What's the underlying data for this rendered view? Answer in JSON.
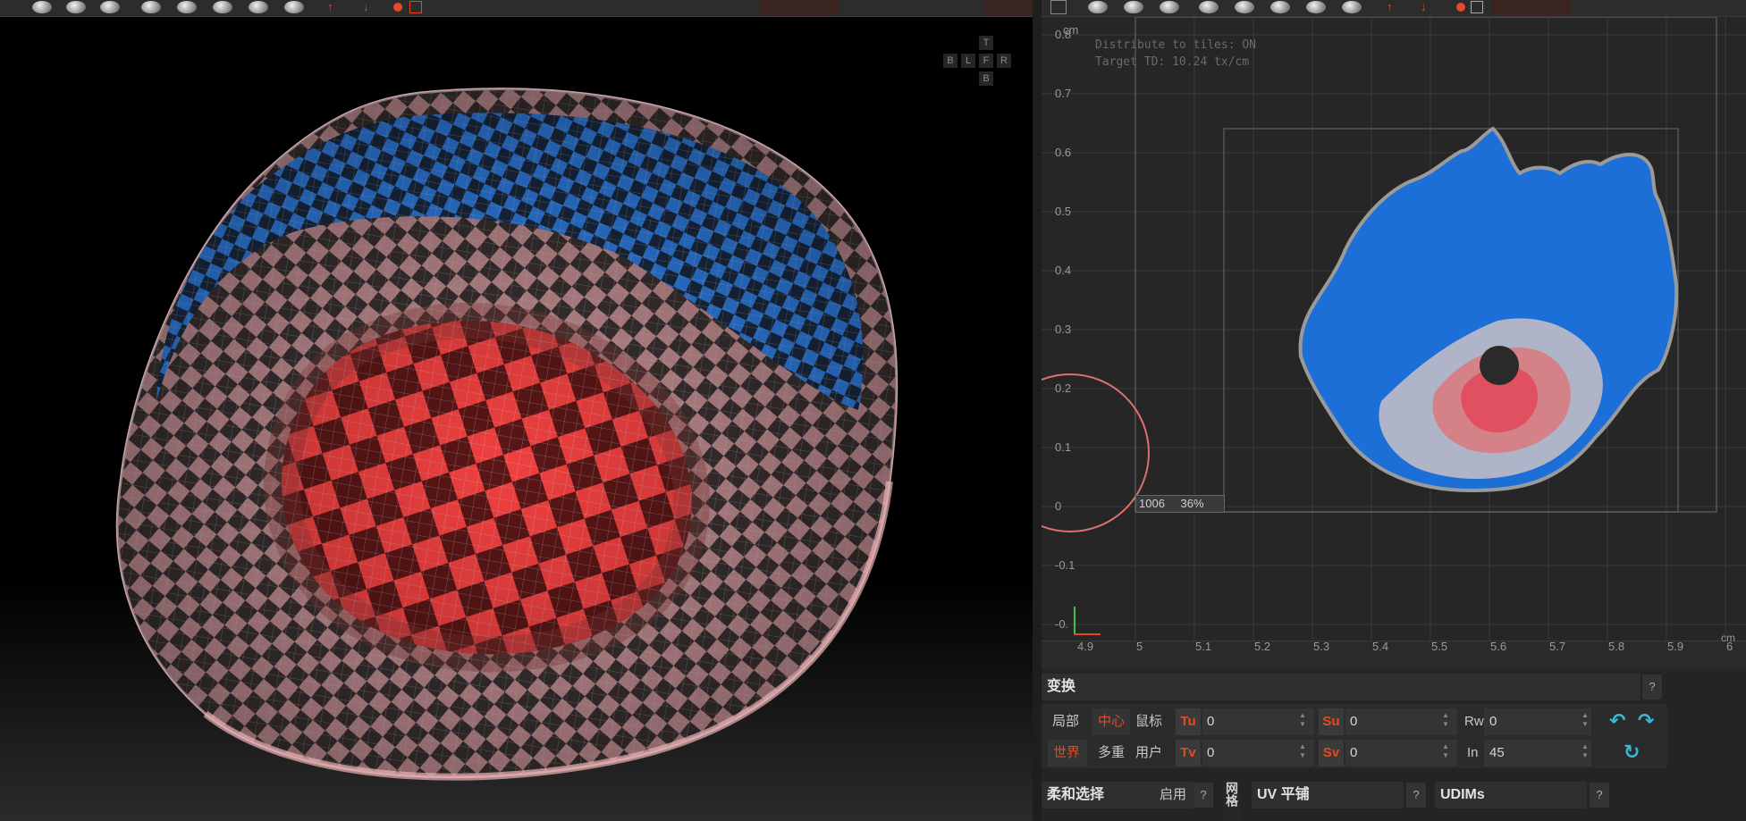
{
  "viewport": {
    "view_cube": {
      "top": "T",
      "back": "B",
      "left": "L",
      "front": "F",
      "right": "R",
      "bottom": "B"
    }
  },
  "uv_editor": {
    "unit_top": "cm",
    "unit_right": "cm",
    "info_line1": "Distribute to tiles: ON",
    "info_line2": "Target TD: 10.24 tx/cm",
    "y_ticks": [
      "0.8",
      "0.7",
      "0.6",
      "0.5",
      "0.4",
      "0.3",
      "0.2",
      "0.1",
      "0",
      "-0.1",
      "-0."
    ],
    "x_ticks": [
      "4.9",
      "5",
      "5.1",
      "5.2",
      "5.3",
      "5.4",
      "5.5",
      "5.6",
      "5.7",
      "5.8",
      "5.9",
      "6"
    ],
    "tile_label": "1006",
    "tile_percent": "36%",
    "colors": {
      "blue": "#1d6fd8",
      "red": "#e0404a",
      "accent": "#e34a24"
    }
  },
  "transform_panel": {
    "title": "变换",
    "help": "?",
    "row1": {
      "local": "局部",
      "center": "中心",
      "mouse": "鼠标",
      "tu": "Tu",
      "tu_val": "0",
      "su": "Su",
      "su_val": "0",
      "rw": "Rw",
      "rw_val": "0"
    },
    "row2": {
      "world": "世界",
      "multi": "多重",
      "user": "用户",
      "tv": "Tv",
      "tv_val": "0",
      "sv": "Sv",
      "sv_val": "0",
      "in": "In",
      "in_val": "45"
    }
  },
  "soft_select": {
    "title": "柔和选择",
    "enable": "启用",
    "help": "?"
  },
  "side_tab": "网格",
  "uv_tile": {
    "title": "UV 平铺",
    "help": "?"
  },
  "udims": {
    "title": "UDIMs",
    "help": "?"
  }
}
